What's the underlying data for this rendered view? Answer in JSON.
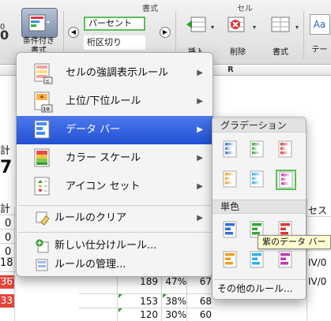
{
  "ribbon": {
    "group_format": "書式",
    "group_cell": "セル",
    "cond_format_label_1": "条件付き",
    "cond_format_label_2": "書式",
    "left_stub_top": "0",
    "left_stub_bottom": "0",
    "style_selected": "パーセント",
    "style_other": "桁区切り",
    "insert_label": "挿入",
    "delete_label": "削除",
    "format_label": "書式",
    "theme_label": "テー",
    "theme_sample": "Aa"
  },
  "sheet": {
    "col_r": "R",
    "left_cells": [
      "計",
      "7",
      "計",
      "0",
      "0",
      "0",
      "18",
      "36",
      "33"
    ],
    "right_cells": [
      "セス",
      "IV/0",
      "IV/0"
    ],
    "tail_rows": [
      {
        "a": "189",
        "b": "47%",
        "c": "67"
      },
      {
        "a": "153",
        "b": "38%",
        "c": "68"
      },
      {
        "a": "120",
        "b": "30%",
        "c": "60"
      }
    ]
  },
  "menu": {
    "items": [
      {
        "label": "セルの強調表示ルール",
        "arrow": "▶"
      },
      {
        "label": "上位/下位ルール",
        "arrow": "▶"
      },
      {
        "label": "データ バー",
        "arrow": "▶"
      },
      {
        "label": "カラー スケール",
        "arrow": "▶"
      },
      {
        "label": "アイコン セット",
        "arrow": "▶"
      },
      {
        "label": "ルールのクリア",
        "arrow": "▶"
      },
      {
        "label": "新しい仕分けルール..."
      },
      {
        "label": "ルールの管理..."
      }
    ],
    "top_bottom_icon_text": "10",
    "selected_index": 2
  },
  "submenu": {
    "gradation_header": "グラデーション",
    "solid_header": "単色",
    "more_rules": "その他のルール...",
    "tooltip": "紫のデータ バー",
    "gradient_colors": [
      "#2f6fd8",
      "#3aa53a",
      "#d63a3a",
      "#f0a020",
      "#2fb0e8",
      "#c03ab0"
    ],
    "solid_colors": [
      "#2f6fd8",
      "#3aa53a",
      "#d63a3a",
      "#f0a020",
      "#2fb0e8",
      "#c03ab0"
    ]
  }
}
